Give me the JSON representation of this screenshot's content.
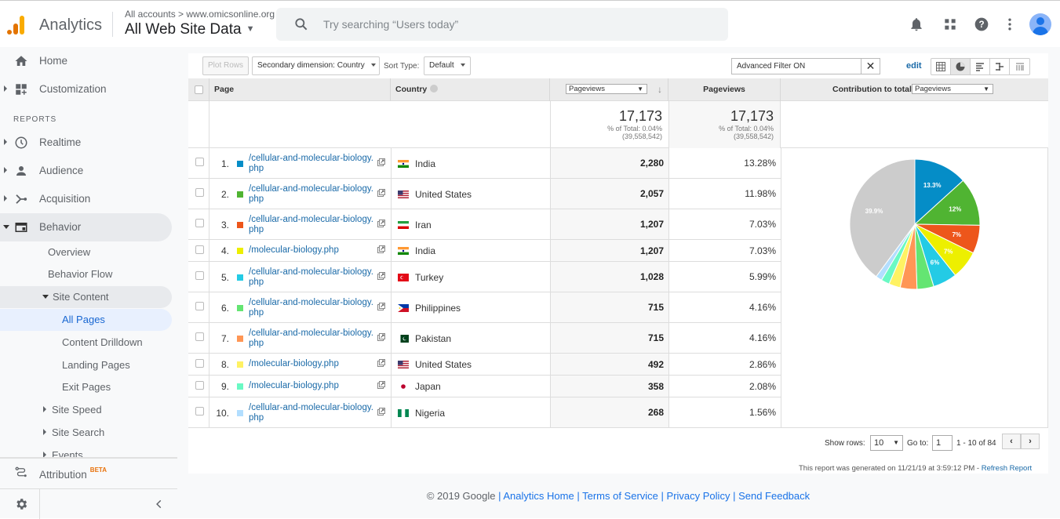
{
  "header": {
    "app_name": "Analytics",
    "breadcrumb": "All accounts > www.omicsonline.org",
    "view_name": "All Web Site Data",
    "search_placeholder": "Try searching “Users today”",
    "icons": [
      "bell-icon",
      "apps-grid-icon",
      "help-icon",
      "more-vert-icon",
      "account-avatar"
    ]
  },
  "sidebar": {
    "top_items": [
      {
        "label": "Home",
        "icon": "home-icon"
      },
      {
        "label": "Customization",
        "icon": "dashboard-plus-icon"
      }
    ],
    "section_heading": "REPORTS",
    "report_items": [
      {
        "label": "Realtime",
        "icon": "clock-icon"
      },
      {
        "label": "Audience",
        "icon": "person-icon"
      },
      {
        "label": "Acquisition",
        "icon": "acquisition-icon"
      },
      {
        "label": "Behavior",
        "icon": "behavior-icon"
      }
    ],
    "behavior_children": [
      "Overview",
      "Behavior Flow"
    ],
    "site_content": {
      "label": "Site Content",
      "children": [
        "All Pages",
        "Content Drilldown",
        "Landing Pages",
        "Exit Pages"
      ],
      "selected": "All Pages"
    },
    "collapsed_groups": [
      "Site Speed",
      "Site Search",
      "Events"
    ],
    "attribution": {
      "label": "Attribution",
      "badge": "BETA"
    }
  },
  "toolbar": {
    "plot_rows": "Plot Rows",
    "secondary_dimension": "Secondary dimension: Country",
    "sort_type_label": "Sort Type:",
    "sort_type_value": "Default",
    "filter_value": "Advanced Filter ON",
    "edit": "edit",
    "view_modes": [
      "table-view-icon",
      "pie-view-icon",
      "performance-view-icon",
      "comparison-view-icon",
      "term-cloud-icon"
    ],
    "active_view": "pie-view-icon"
  },
  "table": {
    "columns": {
      "page": "Page",
      "country": "Country",
      "metric_select": "Pageviews",
      "pageviews": "Pageviews",
      "contribution_label": "Contribution to total:",
      "contribution_select": "Pageviews"
    },
    "summary": [
      {
        "value": "17,173",
        "pct": "% of Total: 0.04%",
        "total": "(39,558,542)"
      },
      {
        "value": "17,173",
        "pct": "% of Total: 0.04%",
        "total": "(39,558,542)"
      }
    ],
    "rows": [
      {
        "idx": "1.",
        "page": "/cellular-and-molecular-biology.php",
        "country": "India",
        "pageviews": "2,280",
        "pct": "13.28%",
        "color": "#058dc7"
      },
      {
        "idx": "2.",
        "page": "/cellular-and-molecular-biology.php",
        "country": "United States",
        "pageviews": "2,057",
        "pct": "11.98%",
        "color": "#50b432"
      },
      {
        "idx": "3.",
        "page": "/cellular-and-molecular-biology.php",
        "country": "Iran",
        "pageviews": "1,207",
        "pct": "7.03%",
        "color": "#ed561b"
      },
      {
        "idx": "4.",
        "page": "/molecular-biology.php",
        "country": "India",
        "pageviews": "1,207",
        "pct": "7.03%",
        "color": "#edef00"
      },
      {
        "idx": "5.",
        "page": "/cellular-and-molecular-biology.php",
        "country": "Turkey",
        "pageviews": "1,028",
        "pct": "5.99%",
        "color": "#24cbe5"
      },
      {
        "idx": "6.",
        "page": "/cellular-and-molecular-biology.php",
        "country": "Philippines",
        "pageviews": "715",
        "pct": "4.16%",
        "color": "#64e572"
      },
      {
        "idx": "7.",
        "page": "/cellular-and-molecular-biology.php",
        "country": "Pakistan",
        "pageviews": "715",
        "pct": "4.16%",
        "color": "#ff9655"
      },
      {
        "idx": "8.",
        "page": "/molecular-biology.php",
        "country": "United States",
        "pageviews": "492",
        "pct": "2.86%",
        "color": "#fff263"
      },
      {
        "idx": "9.",
        "page": "/molecular-biology.php",
        "country": "Japan",
        "pageviews": "358",
        "pct": "2.08%",
        "color": "#6af9c4"
      },
      {
        "idx": "10.",
        "page": "/cellular-and-molecular-biology.php",
        "country": "Nigeria",
        "pageviews": "268",
        "pct": "1.56%",
        "color": "#b2deff"
      }
    ]
  },
  "chart_data": {
    "type": "pie",
    "title": "Contribution to total: Pageviews",
    "categories": [
      "Row 1",
      "Row 2",
      "Row 3",
      "Row 4",
      "Row 5",
      "Row 6",
      "Row 7",
      "Row 8",
      "Row 9",
      "Row 10",
      "Other"
    ],
    "values": [
      13.28,
      11.98,
      7.03,
      7.03,
      5.99,
      4.16,
      4.16,
      2.86,
      2.08,
      1.56,
      39.87
    ],
    "labels": [
      "13.3%",
      "12%",
      "7%",
      "7%",
      "6%",
      "",
      "",
      "",
      "",
      "",
      "39.9%"
    ],
    "colors": [
      "#058dc7",
      "#50b432",
      "#ed561b",
      "#edef00",
      "#24cbe5",
      "#64e572",
      "#ff9655",
      "#fff263",
      "#6af9c4",
      "#b2deff",
      "#cccccc"
    ]
  },
  "pagination": {
    "show_rows_label": "Show rows:",
    "show_rows_value": "10",
    "goto_label": "Go to:",
    "goto_value": "1",
    "range": "1 - 10 of 84"
  },
  "report_info": {
    "generated": "This report was generated on 11/21/19 at 3:59:12 PM - ",
    "refresh": "Refresh Report"
  },
  "footer": {
    "copyright": "© 2019 Google",
    "links": [
      "Analytics Home",
      "Terms of Service",
      "Privacy Policy",
      "Send Feedback"
    ]
  }
}
